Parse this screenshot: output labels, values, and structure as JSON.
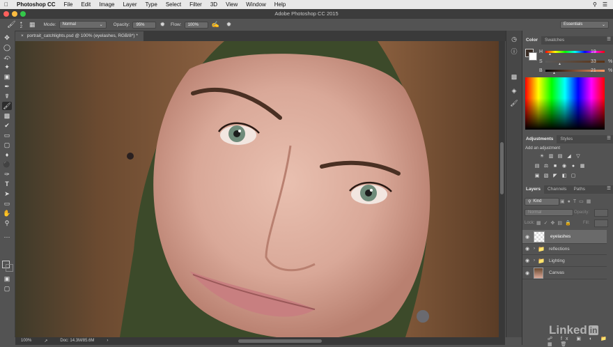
{
  "menubar": {
    "apple": "",
    "app_name": "Photoshop CC",
    "items": [
      "File",
      "Edit",
      "Image",
      "Layer",
      "Type",
      "Select",
      "Filter",
      "3D",
      "View",
      "Window",
      "Help"
    ]
  },
  "window": {
    "title": "Adobe Photoshop CC 2015"
  },
  "options": {
    "brush_size": "2",
    "mode_label": "Mode:",
    "mode_value": "Normal",
    "opacity_label": "Opacity:",
    "opacity_value": "95%",
    "flow_label": "Flow:",
    "flow_value": "100%",
    "workspace": "Essentials"
  },
  "document": {
    "tab_label": "portrait_catchlights.psd @ 100% (eyelashes, RGB/8*) *"
  },
  "status": {
    "zoom": "100%",
    "doc_info": "Doc: 14.3M/85.6M"
  },
  "color_panel": {
    "tabs": [
      "Color",
      "Swatches"
    ],
    "h_label": "H",
    "h_value": "19",
    "s_label": "S",
    "s_value": "33",
    "s_unit": "%",
    "b_label": "B",
    "b_value": "21",
    "b_unit": "%",
    "h_level": 0.05,
    "s_level": 0.33,
    "b_level": 0.21
  },
  "adjustments_panel": {
    "tabs": [
      "Adjustments",
      "Styles"
    ],
    "add_label": "Add an adjustment"
  },
  "layers_panel": {
    "tabs": [
      "Layers",
      "Channels",
      "Paths"
    ],
    "filter_kind": "Kind",
    "blend_mode": "Normal",
    "opacity_label": "Opacity:",
    "lock_label": "Lock:",
    "fill_label": "Fill:",
    "layers": [
      {
        "name": "eyelashes",
        "selected": true,
        "type": "layer"
      },
      {
        "name": "reflections",
        "selected": false,
        "type": "group"
      },
      {
        "name": "Lighting",
        "selected": false,
        "type": "group"
      },
      {
        "name": "Canvas",
        "selected": false,
        "type": "layer"
      }
    ]
  },
  "watermark": {
    "text": "Linked",
    "suffix": "in"
  },
  "colors": {
    "accent": "#0a66c2",
    "fg_swatch": "#3a2d25",
    "bg_swatch": "#ffffff"
  }
}
